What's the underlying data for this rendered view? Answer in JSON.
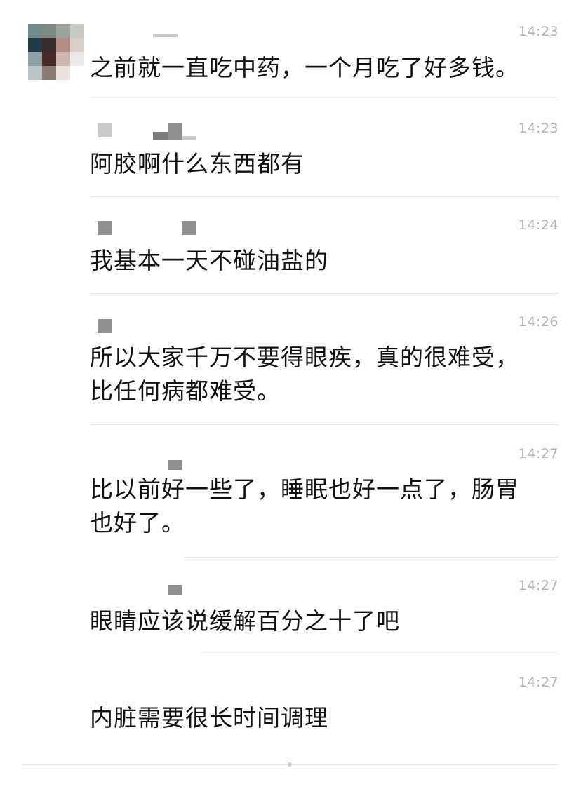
{
  "messages": [
    {
      "time": "14:23",
      "text": "之前就一直吃中药，一个月吃了好多钱。"
    },
    {
      "time": "14:23",
      "text": "阿胶啊什么东西都有"
    },
    {
      "time": "14:24",
      "text": "我基本一天不碰油盐的"
    },
    {
      "time": "14:26",
      "text_line1": "所以大家千万不要得眼疾，真的很难受，",
      "text_line2": "比任何病都难受。"
    },
    {
      "time": "14:27",
      "text_line1": "比以前好一些了，睡眠也好一点了，肠胃",
      "text_line2": "也好了。"
    },
    {
      "time": "14:27",
      "text": "眼睛应该说缓解百分之十了吧"
    },
    {
      "time": "14:27",
      "text": "内脏需要很长时间调理"
    }
  ],
  "avatar": {
    "icon": "blurred-avatar-icon"
  },
  "colors": {
    "timestamp": "#b2b2b2",
    "text": "#111111",
    "divider": "#e5e5e5"
  }
}
